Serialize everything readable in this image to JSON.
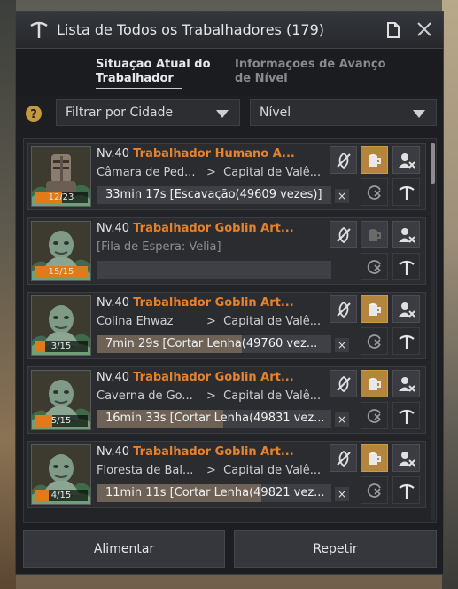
{
  "window": {
    "title": "Lista de Todos os Trabalhadores (179)",
    "title_icon": "pickaxe-icon",
    "doc_icon": "document-icon",
    "close_icon": "close-icon"
  },
  "tabs": [
    {
      "label": "Situação Atual do Trabalhador",
      "active": true
    },
    {
      "label": "Informações de Avanço de Nível",
      "active": false
    }
  ],
  "filters": {
    "help_icon": "help-icon",
    "city_filter": "Filtrar por Cidade",
    "level_filter": "Nível"
  },
  "workers": [
    {
      "level": "Nv.40",
      "name": "Trabalhador Humano A...",
      "origin": "Câmara de Ped...",
      "arrow": ">",
      "destination": "Capital de Valê...",
      "stamina": "12/23",
      "stamina_fraction": 0.52,
      "task": "33min 17s [Escavação(49609 vezes)]",
      "task_fraction": 0.0,
      "task_cancel": "×",
      "feed_state": "active",
      "portrait": "human-worker"
    },
    {
      "level": "Nv.40",
      "name": "Trabalhador Goblin Art...",
      "origin": "[Fila de Espera: Velia]",
      "arrow": "",
      "destination": "",
      "stamina": "15/15",
      "stamina_fraction": 1.0,
      "task": "",
      "task_fraction": 0.0,
      "task_cancel": "",
      "feed_state": "inactive",
      "portrait": "goblin-worker"
    },
    {
      "level": "Nv.40",
      "name": "Trabalhador Goblin Art...",
      "origin": "Colina Ehwaz",
      "arrow": ">",
      "destination": "Capital de Valê...",
      "stamina": "3/15",
      "stamina_fraction": 0.2,
      "task": "7min 29s [Cortar Lenha(49760 vez...",
      "task_fraction": 0.62,
      "task_cancel": "×",
      "feed_state": "active",
      "portrait": "goblin-worker"
    },
    {
      "level": "Nv.40",
      "name": "Trabalhador Goblin Art...",
      "origin": "Caverna de Go...",
      "arrow": ">",
      "destination": "Capital de Valê...",
      "stamina": "5/15",
      "stamina_fraction": 0.33,
      "task": "16min 33s [Cortar Lenha(49831 vez...",
      "task_fraction": 0.54,
      "task_cancel": "×",
      "feed_state": "active",
      "portrait": "goblin-worker"
    },
    {
      "level": "Nv.40",
      "name": "Trabalhador Goblin Art...",
      "origin": "Floresta de Bal...",
      "arrow": ">",
      "destination": "Capital de Valê...",
      "stamina": "4/15",
      "stamina_fraction": 0.27,
      "task": "11min 11s [Cortar Lenha(49821 vez...",
      "task_fraction": 0.7,
      "task_cancel": "×",
      "feed_state": "active",
      "portrait": "goblin-worker"
    }
  ],
  "footer": {
    "feed_label": "Alimentar",
    "repeat_label": "Repetir"
  },
  "colors": {
    "accent_orange": "#e8822a",
    "gold_button": "#b5853b",
    "window_bg": "#1c1e22"
  }
}
